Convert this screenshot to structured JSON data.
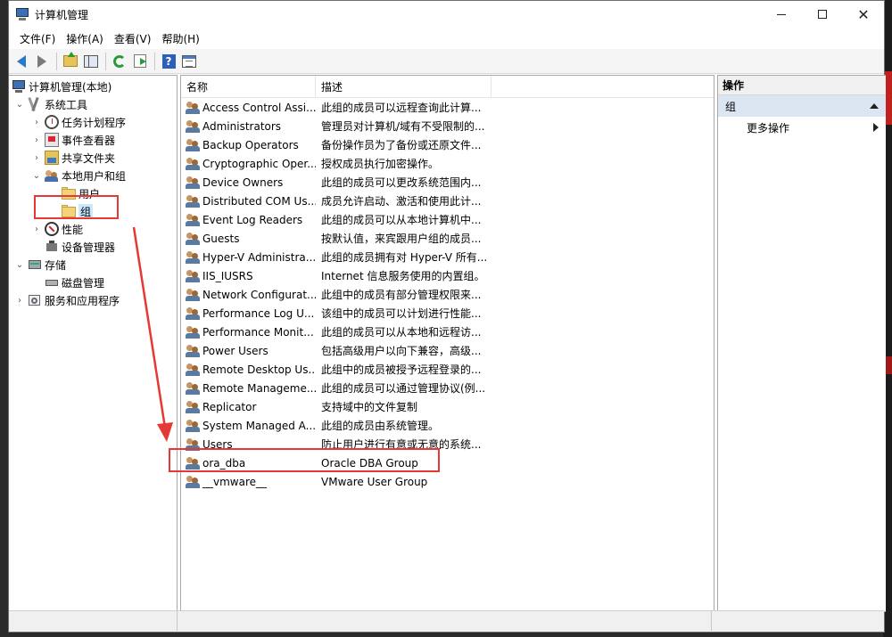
{
  "window": {
    "title": "计算机管理"
  },
  "menu": [
    "文件(F)",
    "操作(A)",
    "查看(V)",
    "帮助(H)"
  ],
  "toolbar": {
    "buttons": [
      "back-icon",
      "forward-icon",
      "up-folder-icon",
      "show-hide-tree-icon",
      "refresh-icon",
      "export-list-icon",
      "help-icon",
      "properties-icon"
    ]
  },
  "tree": {
    "items": [
      {
        "label": "计算机管理(本地)",
        "icon": "computer-icon"
      },
      {
        "label": "系统工具",
        "icon": "tools-icon"
      },
      {
        "label": "任务计划程序",
        "icon": "clock-icon"
      },
      {
        "label": "事件查看器",
        "icon": "event-viewer-icon"
      },
      {
        "label": "共享文件夹",
        "icon": "shared-folder-icon"
      },
      {
        "label": "本地用户和组",
        "icon": "users-icon"
      },
      {
        "label": "用户",
        "icon": "folder-icon"
      },
      {
        "label": "组",
        "icon": "folder-icon"
      },
      {
        "label": "性能",
        "icon": "performance-icon"
      },
      {
        "label": "设备管理器",
        "icon": "device-manager-icon"
      },
      {
        "label": "存储",
        "icon": "storage-icon"
      },
      {
        "label": "磁盘管理",
        "icon": "disk-icon"
      },
      {
        "label": "服务和应用程序",
        "icon": "services-icon"
      }
    ]
  },
  "list": {
    "columns": [
      "名称",
      "描述"
    ],
    "rows": [
      {
        "name": "Access Control Assi...",
        "desc": "此组的成员可以远程查询此计算..."
      },
      {
        "name": "Administrators",
        "desc": "管理员对计算机/域有不受限制的..."
      },
      {
        "name": "Backup Operators",
        "desc": "备份操作员为了备份或还原文件..."
      },
      {
        "name": "Cryptographic Oper...",
        "desc": "授权成员执行加密操作。"
      },
      {
        "name": "Device Owners",
        "desc": "此组的成员可以更改系统范围内..."
      },
      {
        "name": "Distributed COM Us...",
        "desc": "成员允许启动、激活和使用此计..."
      },
      {
        "name": "Event Log Readers",
        "desc": "此组的成员可以从本地计算机中..."
      },
      {
        "name": "Guests",
        "desc": "按默认值，来宾跟用户组的成员..."
      },
      {
        "name": "Hyper-V Administra...",
        "desc": "此组的成员拥有对 Hyper-V 所有..."
      },
      {
        "name": "IIS_IUSRS",
        "desc": "Internet 信息服务使用的内置组。"
      },
      {
        "name": "Network Configurat...",
        "desc": "此组中的成员有部分管理权限来..."
      },
      {
        "name": "Performance Log U...",
        "desc": "该组中的成员可以计划进行性能..."
      },
      {
        "name": "Performance Monit...",
        "desc": "此组的成员可以从本地和远程访..."
      },
      {
        "name": "Power Users",
        "desc": "包括高级用户以向下兼容，高级..."
      },
      {
        "name": "Remote Desktop Us...",
        "desc": "此组中的成员被授予远程登录的..."
      },
      {
        "name": "Remote Manageme...",
        "desc": "此组的成员可以通过管理协议(例..."
      },
      {
        "name": "Replicator",
        "desc": "支持域中的文件复制"
      },
      {
        "name": "System Managed A...",
        "desc": "此组的成员由系统管理。"
      },
      {
        "name": "Users",
        "desc": "防止用户进行有意或无意的系统..."
      },
      {
        "name": "ora_dba",
        "desc": "Oracle DBA Group"
      },
      {
        "name": "__vmware__",
        "desc": "VMware User Group"
      }
    ]
  },
  "actions": {
    "header": "操作",
    "group": "组",
    "more": "更多操作"
  },
  "colors": {
    "highlight": "#e53935",
    "selection": "#cce8ff",
    "action_group_bg": "#dce6f3"
  }
}
